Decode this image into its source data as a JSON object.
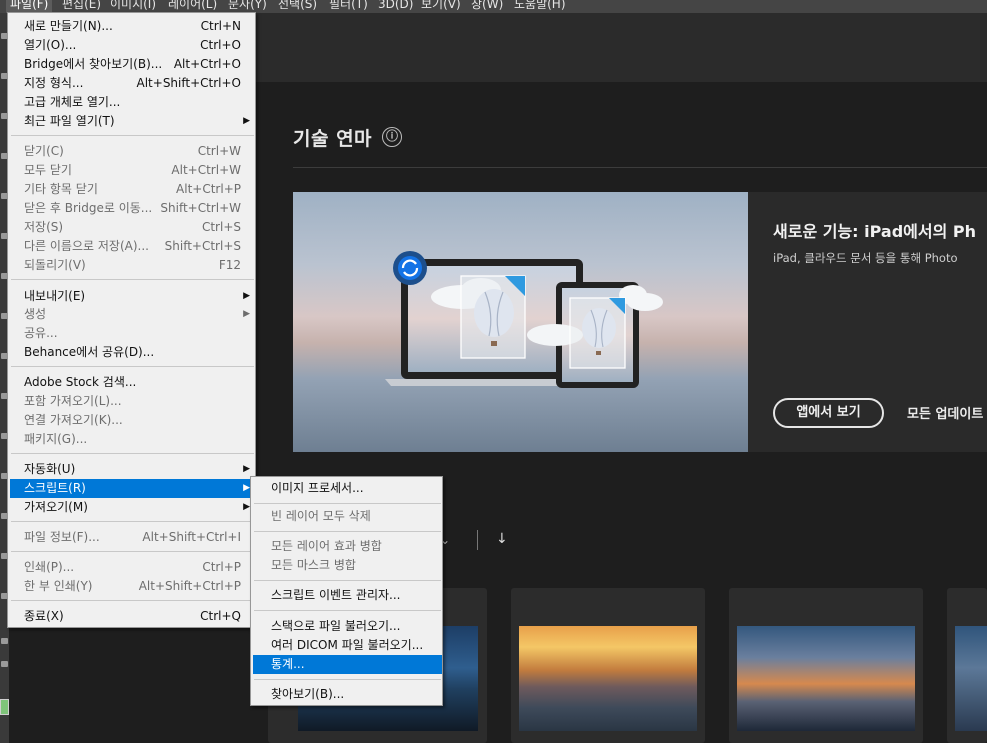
{
  "menubar": {
    "items": [
      {
        "label": "파일(F)",
        "active": true
      },
      {
        "label": "편집(E)"
      },
      {
        "label": "이미지(I)"
      },
      {
        "label": "레이어(L)"
      },
      {
        "label": "문자(Y)"
      },
      {
        "label": "선택(S)"
      },
      {
        "label": "필터(T)"
      },
      {
        "label": "3D(D)"
      },
      {
        "label": "보기(V)"
      },
      {
        "label": "창(W)"
      },
      {
        "label": "도움말(H)"
      }
    ]
  },
  "home": {
    "section_title": "기술 연마",
    "info_icon": "ⓘ",
    "feature": {
      "title": "새로운 기능: iPad에서의 Ph",
      "description": "iPad, 클라우드 문서 등을 통해 Photo",
      "button_label": "앱에서 보기",
      "link_label": "모든 업데이트"
    },
    "sort_chevron": "⌄",
    "sort_arrow": "↓"
  },
  "file_menu": {
    "items": [
      {
        "label": "새로 만들기(N)...",
        "shortcut": "Ctrl+N"
      },
      {
        "label": "열기(O)...",
        "shortcut": "Ctrl+O"
      },
      {
        "label": "Bridge에서 찾아보기(B)...",
        "shortcut": "Alt+Ctrl+O"
      },
      {
        "label": "지정 형식...",
        "shortcut": "Alt+Shift+Ctrl+O"
      },
      {
        "label": "고급 개체로 열기..."
      },
      {
        "label": "최근 파일 열기(T)",
        "submenu": true
      },
      {
        "separator": true
      },
      {
        "label": "닫기(C)",
        "shortcut": "Ctrl+W",
        "disabled": true
      },
      {
        "label": "모두 닫기",
        "shortcut": "Alt+Ctrl+W",
        "disabled": true
      },
      {
        "label": "기타 항목 닫기",
        "shortcut": "Alt+Ctrl+P",
        "disabled": true
      },
      {
        "label": "닫은 후 Bridge로 이동...",
        "shortcut": "Shift+Ctrl+W",
        "disabled": true
      },
      {
        "label": "저장(S)",
        "shortcut": "Ctrl+S",
        "disabled": true
      },
      {
        "label": "다른 이름으로 저장(A)...",
        "shortcut": "Shift+Ctrl+S",
        "disabled": true
      },
      {
        "label": "되돌리기(V)",
        "shortcut": "F12",
        "disabled": true
      },
      {
        "separator": true
      },
      {
        "label": "내보내기(E)",
        "submenu": true
      },
      {
        "label": "생성",
        "submenu": true,
        "disabled": true
      },
      {
        "label": "공유...",
        "disabled": true
      },
      {
        "label": "Behance에서 공유(D)..."
      },
      {
        "separator": true
      },
      {
        "label": "Adobe Stock 검색..."
      },
      {
        "label": "포함 가져오기(L)...",
        "disabled": true
      },
      {
        "label": "연결 가져오기(K)...",
        "disabled": true
      },
      {
        "label": "패키지(G)...",
        "disabled": true
      },
      {
        "separator": true
      },
      {
        "label": "자동화(U)",
        "submenu": true
      },
      {
        "label": "스크립트(R)",
        "submenu": true,
        "highlight": true
      },
      {
        "label": "가져오기(M)",
        "submenu": true
      },
      {
        "separator": true
      },
      {
        "label": "파일 정보(F)...",
        "shortcut": "Alt+Shift+Ctrl+I",
        "disabled": true
      },
      {
        "separator": true
      },
      {
        "label": "인쇄(P)...",
        "shortcut": "Ctrl+P",
        "disabled": true
      },
      {
        "label": "한 부 인쇄(Y)",
        "shortcut": "Alt+Shift+Ctrl+P",
        "disabled": true
      },
      {
        "separator": true
      },
      {
        "label": "종료(X)",
        "shortcut": "Ctrl+Q"
      }
    ]
  },
  "scripts_menu": {
    "items": [
      {
        "label": "이미지 프로세서..."
      },
      {
        "separator": true
      },
      {
        "label": "빈 레이어 모두 삭제",
        "disabled": true
      },
      {
        "separator": true
      },
      {
        "label": "모든 레이어 효과 병합",
        "disabled": true
      },
      {
        "label": "모든 마스크 병합",
        "disabled": true
      },
      {
        "separator": true
      },
      {
        "label": "스크립트 이벤트 관리자..."
      },
      {
        "separator": true
      },
      {
        "label": "스택으로 파일 불러오기..."
      },
      {
        "label": "여러 DICOM 파일 불러오기..."
      },
      {
        "label": "통계...",
        "highlight": true
      },
      {
        "separator": true
      },
      {
        "label": "찾아보기(B)..."
      }
    ]
  }
}
